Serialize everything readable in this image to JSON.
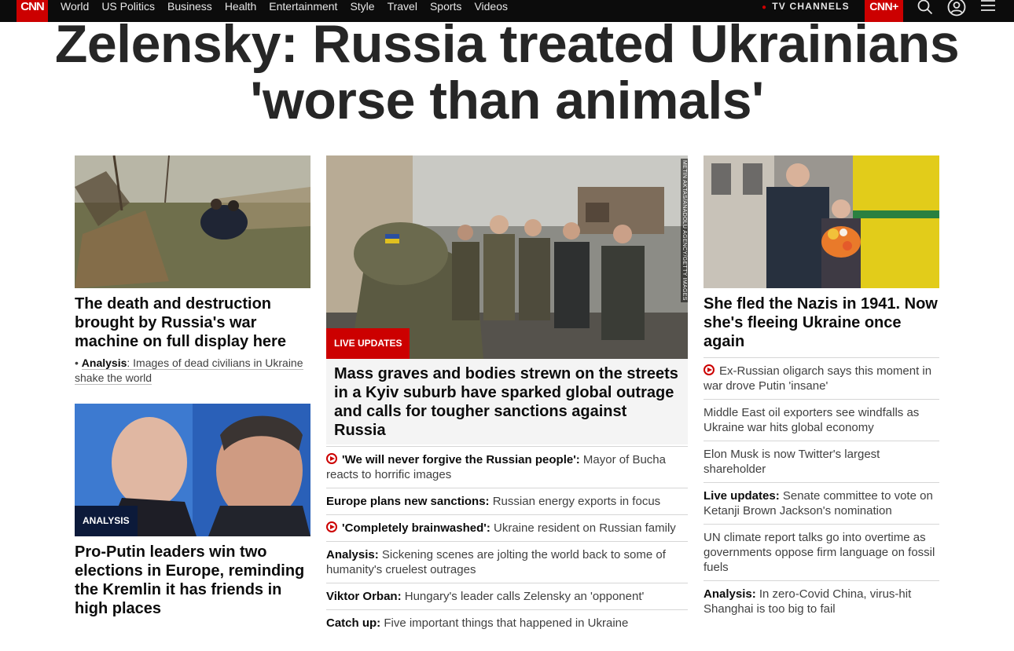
{
  "nav": {
    "logo": "CNN",
    "links": [
      "World",
      "US Politics",
      "Business",
      "Health",
      "Entertainment",
      "Style",
      "Travel",
      "Sports",
      "Videos"
    ],
    "tv_channels": "TV CHANNELS",
    "cnn_plus": "CNN+"
  },
  "headline": "Zelensky: Russia treated Ukrainians 'worse than animals'",
  "left": {
    "story1": {
      "title": "The death and destruction brought by Russia's war machine on full display here",
      "analysis_label": "Analysis",
      "analysis_text": ": Images of dead civilians in Ukraine shake the world"
    },
    "story2": {
      "badge": "ANALYSIS",
      "title": "Pro-Putin leaders win two elections in Europe, reminding the Kremlin it has friends in high places"
    }
  },
  "middle": {
    "badge": "LIVE UPDATES",
    "photo_credit": "METIN AKTAS/ANADOLU AGENCY/GETTY IMAGES",
    "title": "Mass graves and bodies strewn on the streets in a Kyiv suburb have sparked global outrage and calls for tougher sanctions against Russia",
    "items": [
      {
        "bold": "'We will never forgive the Russian people':",
        "text": " Mayor of Bucha reacts to horrific images"
      },
      {
        "bold": "Europe plans new sanctions:",
        "text": " Russian energy exports in focus"
      },
      {
        "bold": "'Completely brainwashed':",
        "text": " Ukraine resident on Russian family"
      },
      {
        "bold": "Analysis:",
        "text": " Sickening scenes are jolting the world back to some of humanity's cruelest outrages"
      },
      {
        "bold": "Viktor Orban:",
        "text": " Hungary's leader calls Zelensky an 'opponent'"
      },
      {
        "bold": "Catch up:",
        "text": " Five important things that happened in Ukraine"
      }
    ]
  },
  "right": {
    "title": "She fled the Nazis in 1941. Now she's fleeing Ukraine once again",
    "items": [
      {
        "bold": "",
        "text": "Ex-Russian oligarch says this moment in war drove Putin 'insane'"
      },
      {
        "bold": "",
        "text": "Middle East oil exporters see windfalls as Ukraine war hits global economy"
      },
      {
        "bold": "",
        "text": "Elon Musk is now Twitter's largest shareholder"
      },
      {
        "bold": "Live updates:",
        "text": " Senate committee to vote on Ketanji Brown Jackson's nomination"
      },
      {
        "bold": "",
        "text": "UN climate report talks go into overtime as governments oppose firm language on fossil fuels"
      },
      {
        "bold": "Analysis:",
        "text": " In zero-Covid China, virus-hit Shanghai is too big to fail"
      }
    ]
  },
  "colors": {
    "cnn_red": "#cc0000",
    "nav_bg": "#0c0c0c",
    "analysis_badge": "#0c1a3a"
  }
}
